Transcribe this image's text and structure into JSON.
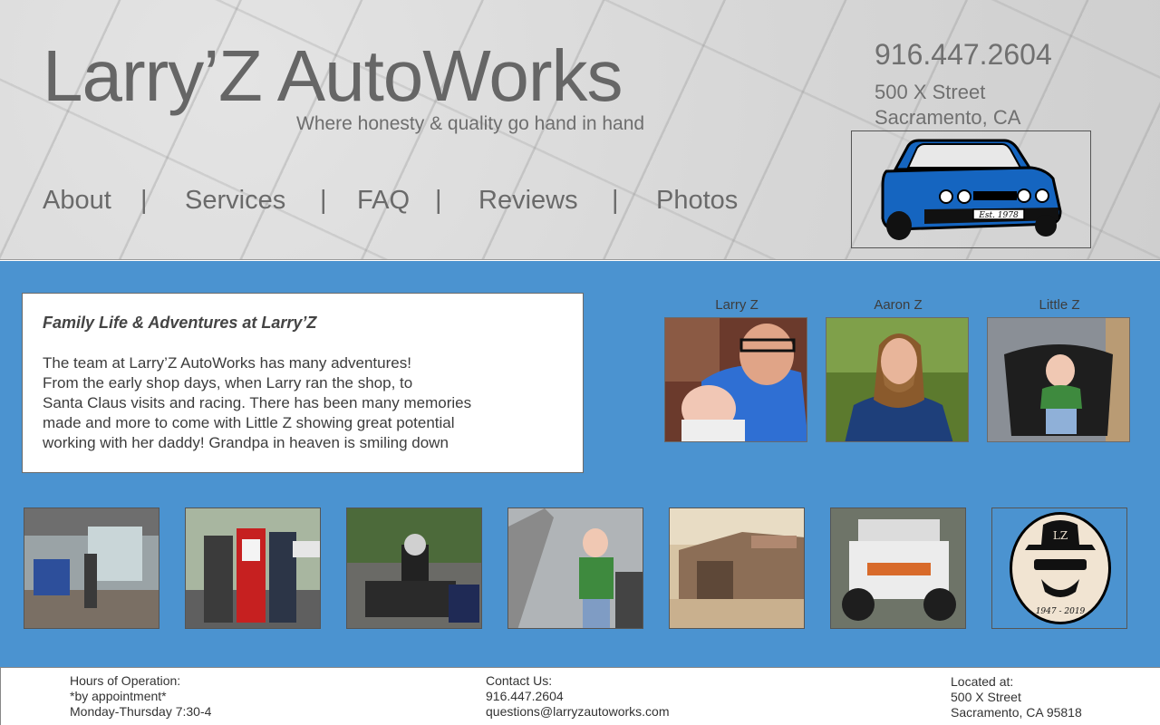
{
  "header": {
    "title": "Larry’Z AutoWorks",
    "tagline": "Where honesty & quality go hand in hand",
    "phone": "916.447.2604",
    "address_line1": "500 X Street",
    "address_line2": "Sacramento, CA",
    "car_badge": "Est. 1978"
  },
  "nav": {
    "items": [
      {
        "label": "About"
      },
      {
        "label": "Services"
      },
      {
        "label": "FAQ"
      },
      {
        "label": "Reviews"
      },
      {
        "label": "Photos"
      }
    ],
    "separator": "|"
  },
  "story": {
    "title": "Family Life & Adventures at Larry’Z",
    "lines": [
      "The team at Larry’Z AutoWorks has many adventures!",
      "From the early shop days, when Larry ran the shop, to",
      "Santa Claus visits and racing. There has been many memories",
      "made and more to come with Little Z showing great potential",
      "working with her daddy! Grandpa in heaven is smiling down"
    ]
  },
  "team": [
    {
      "name": "Larry Z"
    },
    {
      "name": "Aaron Z"
    },
    {
      "name": "Little Z"
    }
  ],
  "logo_badge": {
    "initials": "LZ",
    "years": "1947 - 2019"
  },
  "footer": {
    "hours_label": "Hours of Operation:",
    "hours_note": "*by appointment*",
    "hours_value": "Monday-Thursday 7:30-4",
    "contact_label": "Contact Us:",
    "contact_phone": "916.447.2604",
    "contact_email": "questions@larryzautoworks.com",
    "location_label": "Located at:",
    "location_line1": "500 X Street",
    "location_line2": "Sacramento, CA 95818"
  },
  "colors": {
    "main_bg": "#4b93d0",
    "car_blue": "#1565c0",
    "header_text": "#666666"
  }
}
